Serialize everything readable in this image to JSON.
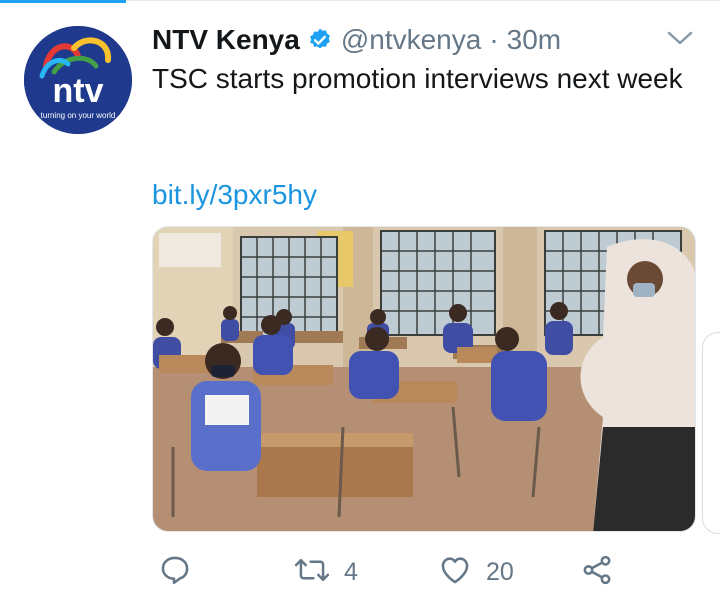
{
  "colors": {
    "accent": "#1da1f2",
    "link": "#1b95e0",
    "text": "#14171a",
    "secondary": "#657786",
    "avatar_bg": "#1f3a8c"
  },
  "tweet": {
    "author": {
      "name": "NTV Kenya",
      "handle": "@ntvkenya",
      "verified": true,
      "avatar": {
        "brand": "ntv",
        "tagline": "turning on your world"
      }
    },
    "separator": "·",
    "time": "30m",
    "text": "TSC starts promotion interviews next week",
    "link": "bit.ly/3pxr5hy",
    "media": {
      "type": "photo",
      "subject": "classroom-with-masked-students"
    },
    "actions": {
      "reply": {
        "icon": "reply-icon",
        "count": ""
      },
      "retweet": {
        "icon": "retweet-icon",
        "count": "4"
      },
      "like": {
        "icon": "heart-icon",
        "count": "20"
      },
      "share": {
        "icon": "share-icon"
      }
    }
  }
}
